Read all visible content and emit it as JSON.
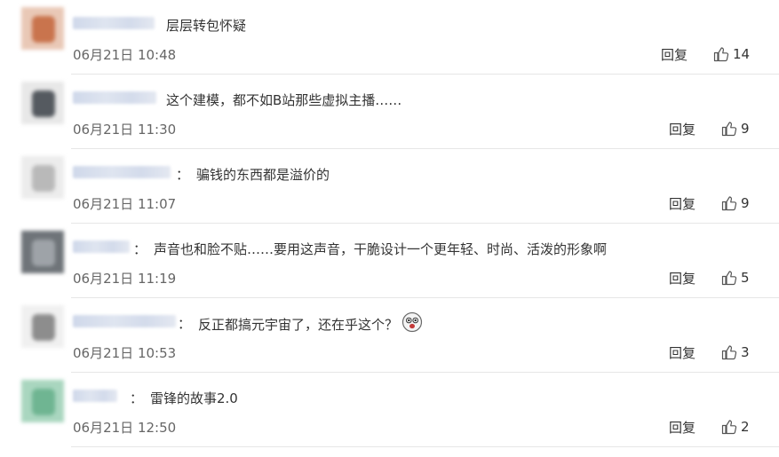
{
  "comments": [
    {
      "text": "层层转包怀疑",
      "time": "06月21日 10:48",
      "reply_label": "回复",
      "likes": "14",
      "has_colon": false,
      "avatar_colors": [
        "#e9c8b6",
        "#c9744d"
      ]
    },
    {
      "text": "这个建模，都不如B站那些虚拟主播……",
      "time": "06月21日 11:30",
      "reply_label": "回复",
      "likes": "9",
      "has_colon": false,
      "avatar_colors": [
        "#e8e8e8",
        "#555a60"
      ]
    },
    {
      "colon": "：",
      "text": "骗钱的东西都是溢价的",
      "time": "06月21日 11:07",
      "reply_label": "回复",
      "likes": "9",
      "has_colon": true,
      "avatar_colors": [
        "#ececec",
        "#b9b9b9"
      ]
    },
    {
      "colon": "：",
      "text": "声音也和脸不贴……要用这声音，干脆设计一个更年轻、时尚、活泼的形象啊",
      "time": "06月21日 11:19",
      "reply_label": "回复",
      "likes": "5",
      "has_colon": true,
      "avatar_colors": [
        "#6f7479",
        "#9ea3a8"
      ]
    },
    {
      "colon": "：",
      "text": "反正都搞元宇宙了，还在乎这个？",
      "time": "06月21日 10:53",
      "reply_label": "回复",
      "likes": "3",
      "has_colon": true,
      "avatar_colors": [
        "#f0f0f0",
        "#8d8d8d"
      ]
    },
    {
      "colon": "：",
      "text": "雷锋的故事2.0",
      "time": "06月21日 12:50",
      "reply_label": "回复",
      "likes": "2",
      "has_colon": true,
      "avatar_colors": [
        "#a9d6bf",
        "#6fb592"
      ]
    }
  ],
  "icons": {
    "like": "thumbs-up-icon",
    "emoji": "dizzy-face-emoji-icon"
  },
  "colors": {
    "text": "#333333",
    "time": "#666666",
    "divider": "#e6e6e6",
    "username_blur": "#d6deee"
  }
}
